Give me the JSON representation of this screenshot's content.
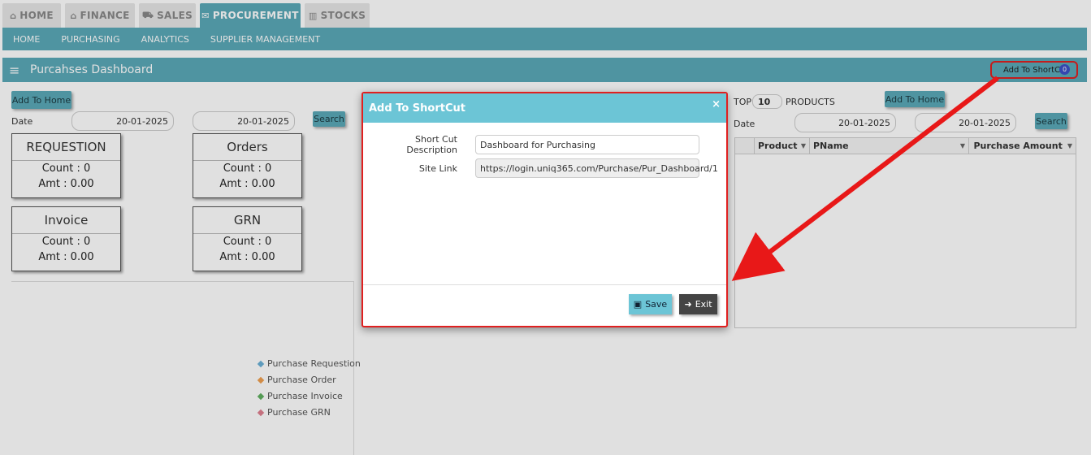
{
  "top_tabs": [
    {
      "label": "HOME",
      "icon": "home-icon"
    },
    {
      "label": "FINANCE",
      "icon": "bank-icon"
    },
    {
      "label": "SALES",
      "icon": "cart-icon"
    },
    {
      "label": "PROCUREMENT",
      "icon": "megaphone-icon"
    },
    {
      "label": "STOCKS",
      "icon": "bar-chart-icon"
    }
  ],
  "sub_nav": [
    "HOME",
    "PURCHASING",
    "ANALYTICS",
    "SUPPLIER MANAGEMENT"
  ],
  "panel": {
    "title": "Purcahses Dashboard",
    "shortcut_label": "Add To ShortCut",
    "shortcut_badge": "0"
  },
  "left": {
    "add_home": "Add To Home",
    "date_label": "Date",
    "date_from": "20-01-2025",
    "date_to": "20-01-2025",
    "search": "Search",
    "cards": [
      {
        "title": "REQUESTION",
        "count": "Count : 0",
        "amt": "Amt : 0.00"
      },
      {
        "title": "Orders",
        "count": "Count : 0",
        "amt": "Amt : 0.00"
      },
      {
        "title": "Invoice",
        "count": "Count : 0",
        "amt": "Amt : 0.00"
      },
      {
        "title": "GRN",
        "count": "Count : 0",
        "amt": "Amt : 0.00"
      }
    ],
    "legend": [
      {
        "label": "Purchase Requestion",
        "color": "#6ab0d6"
      },
      {
        "label": "Purchase Order",
        "color": "#f0a050"
      },
      {
        "label": "Purchase Invoice",
        "color": "#60b060"
      },
      {
        "label": "Purchase GRN",
        "color": "#e08090"
      }
    ]
  },
  "right": {
    "top_label": "TOP",
    "top_value": "10",
    "products_label": "PRODUCTS",
    "add_home": "Add To Home",
    "date_label": "Date",
    "date_from": "20-01-2025",
    "date_to": "20-01-2025",
    "search": "Search",
    "columns": [
      "Product",
      "PName",
      "Purchase Amount"
    ]
  },
  "modal": {
    "title": "Add To ShortCut",
    "close": "×",
    "desc_label": "Short Cut Description",
    "desc_value": "Dashboard for Purchasing",
    "link_label": "Site Link",
    "link_value": "https://login.uniq365.com/Purchase/Pur_Dashboard/1",
    "save": "Save",
    "exit": "Exit"
  }
}
